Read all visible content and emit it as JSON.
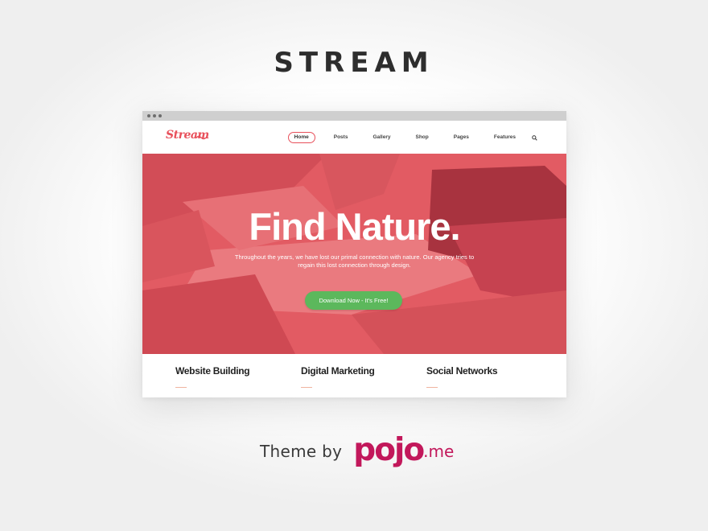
{
  "page": {
    "title": "STREAM",
    "credit_prefix": "Theme by",
    "credit_brand": "pojo",
    "credit_suffix": ".me"
  },
  "site": {
    "logo": "Stream",
    "menu": [
      {
        "label": "Home",
        "active": true
      },
      {
        "label": "Posts",
        "active": false
      },
      {
        "label": "Gallery",
        "active": false
      },
      {
        "label": "Shop",
        "active": false
      },
      {
        "label": "Pages",
        "active": false
      },
      {
        "label": "Features",
        "active": false
      }
    ],
    "search_icon": "search-icon"
  },
  "hero": {
    "title": "Find Nature.",
    "text": "Throughout the years, we have lost our primal connection with nature. Our agency tries to regain this lost connection through design.",
    "cta_label": "Download Now - It's Free!"
  },
  "features": [
    {
      "title": "Website Building"
    },
    {
      "title": "Digital Marketing"
    },
    {
      "title": "Social Networks"
    }
  ],
  "colors": {
    "accent": "#e8505b",
    "cta": "#5cb85c",
    "brand": "#c2185b"
  }
}
